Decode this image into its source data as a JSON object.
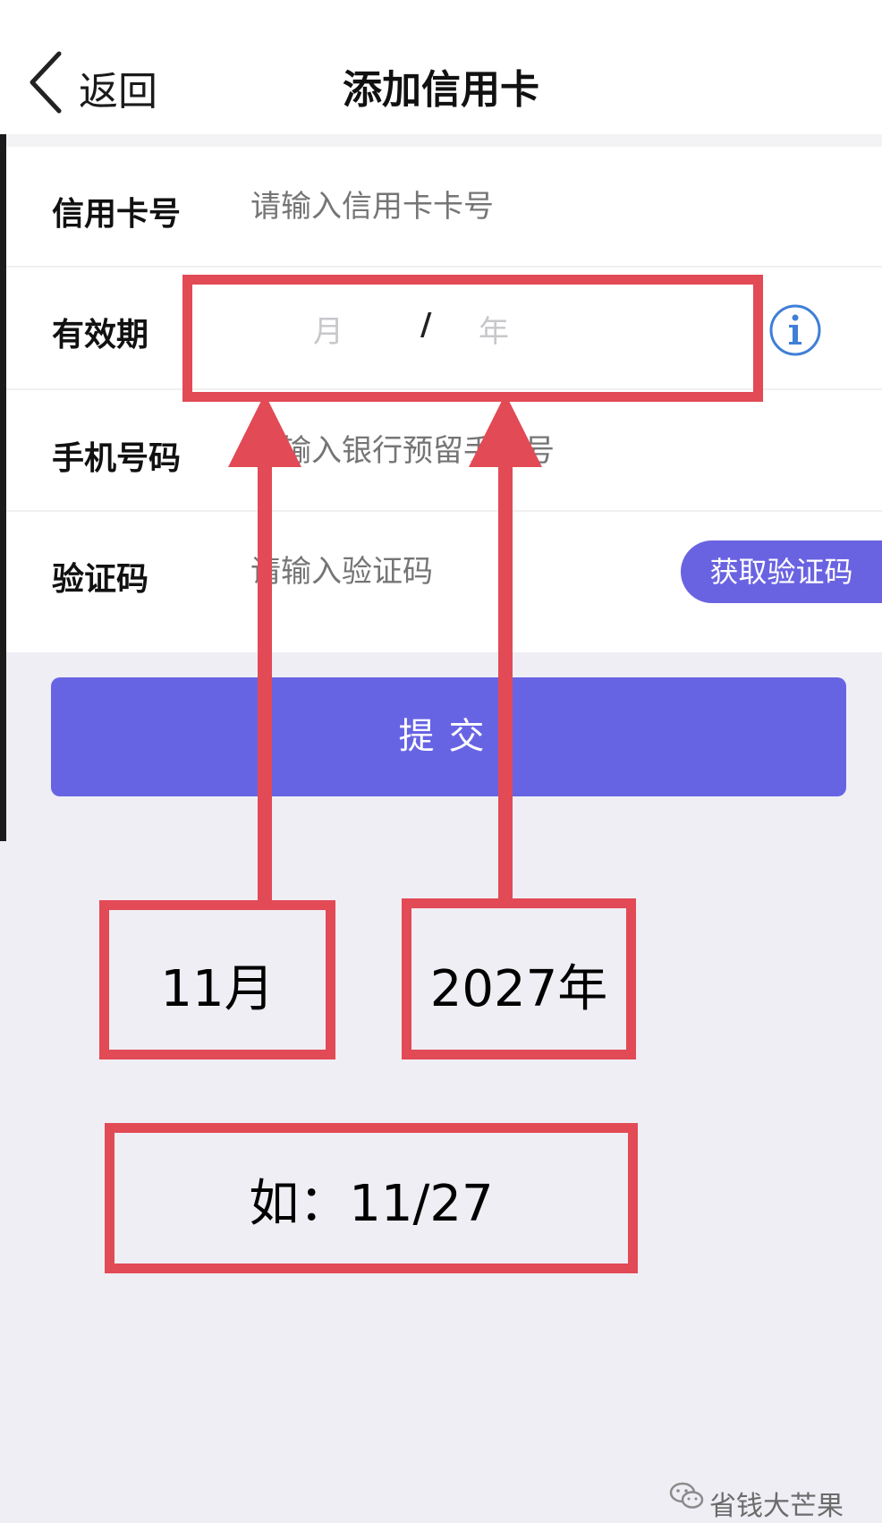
{
  "header": {
    "back_label": "返回",
    "title": "添加信用卡"
  },
  "form": {
    "card_number": {
      "label": "信用卡号",
      "placeholder": "请输入信用卡卡号"
    },
    "expiry": {
      "label": "有效期",
      "month_placeholder": "月",
      "separator": "/",
      "year_placeholder": "年"
    },
    "phone": {
      "label": "手机号码",
      "placeholder": "请输入银行预留手机号"
    },
    "code": {
      "label": "验证码",
      "placeholder": "请输入验证码",
      "button_label": "获取验证码"
    },
    "submit_label": "提交"
  },
  "annotations": {
    "month_example": "11月",
    "year_example": "2027年",
    "combined_example": "如：11/27"
  },
  "watermark": "省钱大芒果",
  "colors": {
    "accent": "#6764e4",
    "annotation": "#e24a55"
  }
}
